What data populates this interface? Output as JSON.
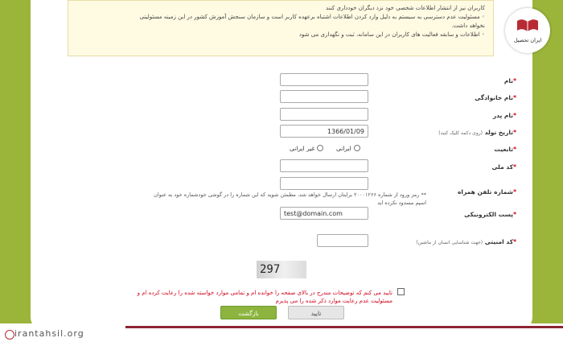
{
  "notice": {
    "lines": [
      "کاربران نیز از انتشار اطلاعات شخصی خود نزد دیگران خودداری کنند",
      "مسئولیت عدم دسترسی به سیستم به دلیل وارد کردن اطلاعات اشتباه برعهده کاربر است و سازمان سنجش آموزش کشور در این زمینه مسئولیتی",
      "نخواهد داشت.",
      "اطلاعات و سابقه فعالیت های کاربران در این سامانه، ثبت و نگهداری می شود"
    ]
  },
  "form": {
    "first_name": {
      "label": "نام",
      "value": ""
    },
    "last_name": {
      "label": "نام خانوادگی",
      "value": ""
    },
    "father_name": {
      "label": "نام پدر",
      "value": ""
    },
    "birth_date": {
      "label": "تاریخ تولد",
      "hint": "(روی دکمه کلیک کنید)",
      "value": "1366/01/09"
    },
    "nationality": {
      "label": "تابعیت",
      "options": [
        "ایرانی",
        "غیر ایرانی"
      ]
    },
    "national_code": {
      "label": "کد ملی",
      "value": ""
    },
    "mobile": {
      "label": "شماره تلفن همراه",
      "value": "",
      "hint_line1": "** رمز ورود از شماره ۲۰۰۰۱۲۶۶ برایتان ارسال خواهد شد، مطمئن شوید که این شماره را در گوشی خودشماره خود به عنوان",
      "hint_line2": "اسپم مسدود نکرده اید"
    },
    "email": {
      "label": "پست الکترونیکی",
      "value": "test@domain.com"
    },
    "security_code": {
      "label": "کد امنیتی",
      "hint": "(جهت شناسایی انسان از ماشین)",
      "value": ""
    },
    "captcha_text": "297",
    "agreement": "تایید می کنم که توضیحات مندرج در بالای صفحه را خوانده ام و تمامی موارد خواسته شده را رعایت کرده ام و مسئولیت عدم رعایت موارد ذکر شده را می پذیرم",
    "back_button": "بازگشت",
    "confirm_button": "تایید"
  },
  "brand": {
    "site": "irantahsil.org",
    "logo_name": "ایران تحصیل"
  },
  "colors": {
    "accent": "#8cb43f",
    "required": "#d0021b",
    "brand": "#8c2332"
  }
}
